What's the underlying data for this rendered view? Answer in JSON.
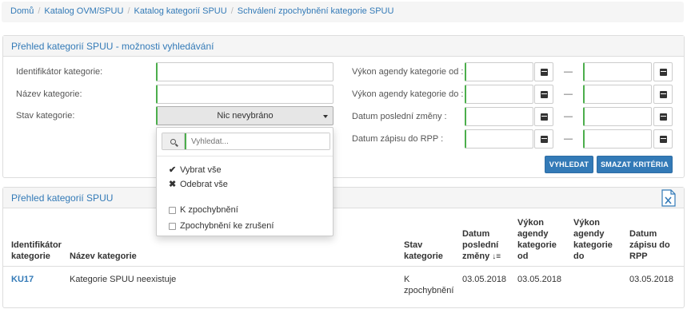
{
  "breadcrumb": {
    "items": [
      "Domů",
      "Katalog OVM/SPUU",
      "Katalog kategorií SPUU",
      "Schválení zpochybnění kategorie SPUU"
    ],
    "separator": "/"
  },
  "search_panel": {
    "title": "Přehled kategorií SPUU - možnosti vyhledávání",
    "labels": {
      "identifier": "Identifikátor kategorie:",
      "name": "Název kategorie:",
      "status": "Stav kategorie:",
      "agenda_from": "Výkon agendy kategorie od :",
      "agenda_to": "Výkon agendy kategorie do :",
      "last_change": "Datum poslední změny :",
      "rpp_date": "Datum zápisu do RPP :"
    },
    "dash": "—",
    "status_select": {
      "value": "Nic nevybráno"
    },
    "buttons": {
      "search": "VYHLEDAT",
      "clear": "SMAZAT KRITÉRIA"
    }
  },
  "dropdown": {
    "search_placeholder": "Vyhledat...",
    "select_all": "Vybrat vše",
    "deselect_all": "Odebrat vše",
    "options": [
      "K zpochybnění",
      "Zpochybnění ke zrušení"
    ]
  },
  "list_panel": {
    "title": "Přehled kategorií SPUU",
    "export_icon": "excel-export-icon",
    "columns": {
      "identifier": [
        "Identifikátor",
        "kategorie"
      ],
      "name": [
        "Název kategorie"
      ],
      "status": [
        "Stav",
        "kategorie"
      ],
      "last_change": [
        "Datum",
        "poslední",
        "změny"
      ],
      "agenda_from": [
        "Výkon",
        "agendy",
        "kategorie",
        "od"
      ],
      "agenda_to": [
        "Výkon",
        "agendy",
        "kategorie",
        "do"
      ],
      "rpp_date": [
        "Datum",
        "zápisu do",
        "RPP"
      ]
    },
    "sort_icon": "sort-desc-icon",
    "rows": [
      {
        "identifier": "KU17",
        "name": "Kategorie SPUU neexistuje",
        "status": [
          "K",
          "zpochybnění"
        ],
        "last_change": "03.05.2018",
        "agenda_from": "03.05.2018",
        "agenda_to": "",
        "rpp_date": "03.05.2018"
      }
    ]
  },
  "colors": {
    "link": "#337ab7",
    "primary_button": "#337ab7",
    "valid_border": "#4cae4c",
    "panel_heading_bg": "#f5f5f5"
  }
}
